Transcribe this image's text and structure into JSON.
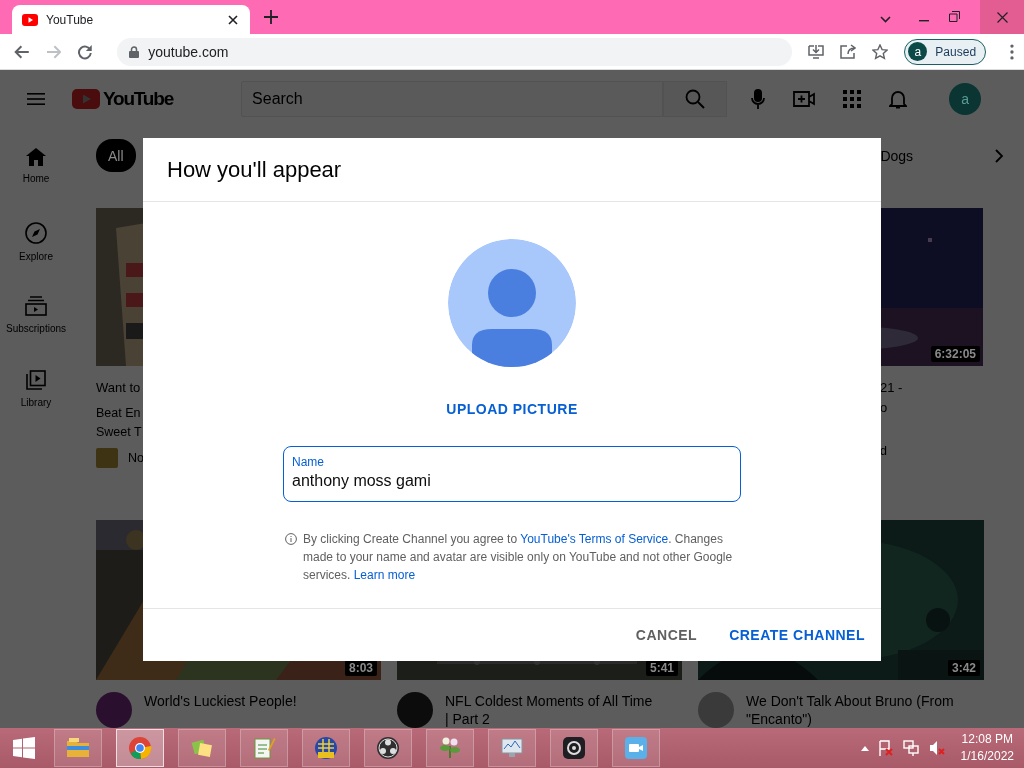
{
  "browser": {
    "tab": {
      "title": "YouTube",
      "selected": true
    },
    "nav": [
      {
        "kind": "back",
        "disabled": false
      },
      {
        "kind": "forward",
        "disabled": true
      },
      {
        "kind": "reload",
        "disabled": false
      }
    ],
    "url": "youtube.com",
    "profile": {
      "initial": "a",
      "status": "Paused"
    }
  },
  "page": {
    "logo": "YouTube",
    "search": {
      "placeholder": "Search"
    },
    "avatar_initial": "a",
    "guide": [
      {
        "kind": "home",
        "label": "Home"
      },
      {
        "kind": "explore",
        "label": "Explore"
      },
      {
        "kind": "subscriptions",
        "label": "Subscriptions"
      },
      {
        "kind": "library",
        "label": "Library"
      }
    ],
    "chips": [
      {
        "label": "All",
        "selected": true
      },
      {
        "label": "Dogs",
        "selected": false
      }
    ],
    "feed_top": [
      {
        "kind": "cut-left",
        "title_lines": [
          "Want to"
        ],
        "meta_lines": [
          "Beat En",
          "Sweet T"
        ],
        "badge_text": "No"
      },
      {
        "kind": "cut-right",
        "duration": "6:32:05",
        "title_lines": [
          "21 -",
          "o"
        ],
        "meta_lines": [
          "d"
        ]
      }
    ],
    "feed_bottom": [
      {
        "duration": "8:03",
        "title_lines": [
          "World's Luckiest People!"
        ]
      },
      {
        "duration": "5:41",
        "title_lines": [
          "NFL Coldest Moments of All Time",
          "| Part 2"
        ]
      },
      {
        "duration": "3:42",
        "title_lines": [
          "We Don't Talk About Bruno (From",
          "\"Encanto\")"
        ]
      }
    ]
  },
  "dialog": {
    "title": "How you'll appear",
    "upload_label": "UPLOAD PICTURE",
    "name_field": {
      "label": "Name",
      "value": "anthony moss gami"
    },
    "notice": [
      {
        "kind": "text",
        "text": "By clicking Create Channel you agree to "
      },
      {
        "kind": "link",
        "text": "YouTube's Terms of Service"
      },
      {
        "kind": "text",
        "text": ". Changes made to your name and avatar are visible only on YouTube and not other Google services. "
      },
      {
        "kind": "link",
        "text": "Learn more"
      }
    ],
    "buttons": [
      {
        "kind": "secondary",
        "label": "CANCEL"
      },
      {
        "kind": "primary",
        "label": "CREATE CHANNEL"
      }
    ]
  },
  "taskbar": {
    "apps": [
      {
        "kind": "folder",
        "selected": false
      },
      {
        "kind": "browser",
        "selected": true
      },
      {
        "kind": "notes",
        "selected": false
      },
      {
        "kind": "notepad",
        "selected": false
      },
      {
        "kind": "game",
        "selected": false
      },
      {
        "kind": "record",
        "selected": false
      },
      {
        "kind": "plant",
        "selected": false
      },
      {
        "kind": "monitor",
        "selected": false
      },
      {
        "kind": "camera",
        "selected": false
      },
      {
        "kind": "video",
        "selected": false
      }
    ],
    "clock": {
      "time": "12:08 PM",
      "date": "1/16/2022"
    }
  }
}
